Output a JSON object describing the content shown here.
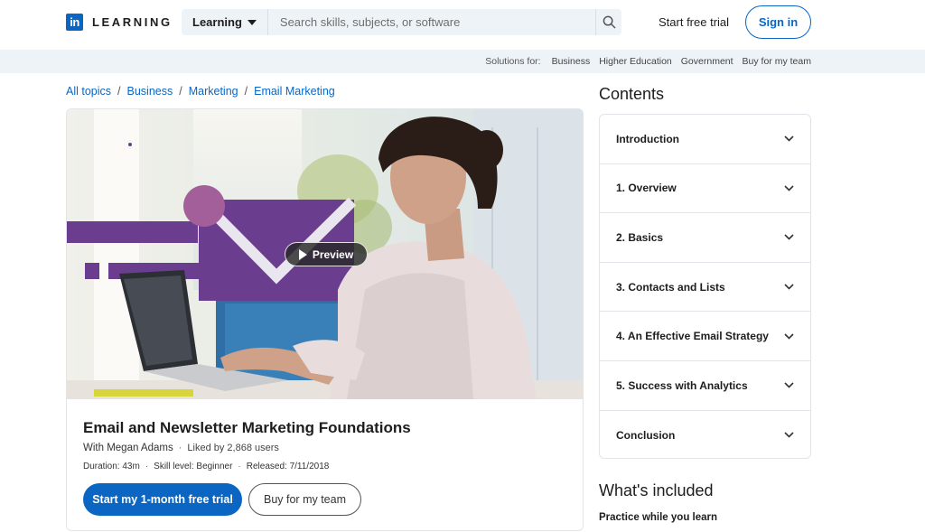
{
  "brand": {
    "logo_mark": "in",
    "product": "LEARNING"
  },
  "search": {
    "dropdown_label": "Learning",
    "placeholder": "Search skills, subjects, or software",
    "icon": "search-icon"
  },
  "header": {
    "free_trial": "Start free trial",
    "sign_in": "Sign in"
  },
  "solutions": {
    "label": "Solutions for:",
    "links": [
      "Business",
      "Higher Education",
      "Government",
      "Buy for my team"
    ]
  },
  "breadcrumb": [
    "All topics",
    "Business",
    "Marketing",
    "Email Marketing"
  ],
  "course": {
    "preview_label": "Preview",
    "title": "Email and Newsletter Marketing Foundations",
    "author": "With Megan Adams",
    "likes": "Liked by 2,868 users",
    "duration": "Duration: 43m",
    "skill": "Skill level: Beginner",
    "released": "Released: 7/11/2018",
    "cta_primary": "Start my 1-month free trial",
    "cta_secondary": "Buy for my team"
  },
  "contents": {
    "title": "Contents",
    "items": [
      "Introduction",
      "1. Overview",
      "2. Basics",
      "3. Contacts and Lists",
      "4. An Effective Email Strategy",
      "5. Success with Analytics",
      "Conclusion"
    ]
  },
  "included": {
    "title": "What's included",
    "first_item": "Practice while you learn"
  },
  "colors": {
    "accent": "#0a66c2",
    "brand_purple": "#6b3d8e"
  }
}
